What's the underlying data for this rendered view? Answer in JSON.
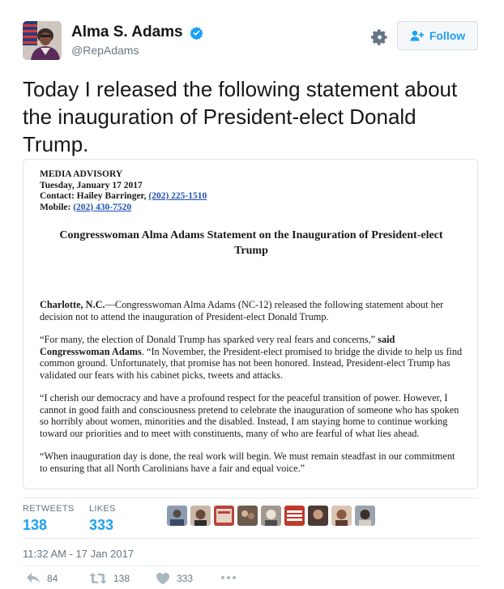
{
  "author": {
    "display_name": "Alma S. Adams",
    "handle": "@RepAdams"
  },
  "follow_button": {
    "label": "Follow"
  },
  "tweet": {
    "text": "Today I released the following statement about the inauguration of President-elect Donald Trump."
  },
  "document": {
    "advisory": "MEDIA ADVISORY",
    "date": "Tuesday, January 17 2017",
    "contact_prefix": "Contact: Hailey Barringer, ",
    "contact_phone": "(202) 225-1510",
    "mobile_prefix": "Mobile: ",
    "mobile_phone": "(202) 430-7520",
    "title": "Congresswoman Alma Adams Statement on the Inauguration of President-elect Trump",
    "p1_lead": "Charlotte, N.C.",
    "p1_body": "—Congresswoman Alma Adams (NC-12) released the following statement about her decision not to attend the inauguration of President-elect Donald Trump.",
    "p2_quote": "“For many, the election of Donald Trump has sparked very real fears and concerns,”",
    "p2_said": " said Congresswoman Adams",
    "p2_body": ". “In November, the President-elect promised to bridge the divide to help us find common ground.  Unfortunately, that promise has not been honored.  Instead, President-elect Trump has validated our fears with his cabinet picks, tweets and attacks.",
    "p3": "“I cherish our democracy and have a profound respect for the peaceful transition of power.  However, I cannot in good faith and consciousness pretend to celebrate the inauguration of someone who has spoken so horribly about women, minorities and the disabled. Instead, I am staying home to continue working toward our priorities and to meet with constituents, many of who are fearful of what lies ahead.",
    "p4": "“When inauguration day is done, the real work will begin. We must remain steadfast in our commitment to ensuring that all North Carolinians have a fair and equal voice.”"
  },
  "stats": {
    "retweets_label": "RETWEETS",
    "retweets_count": "138",
    "likes_label": "LIKES",
    "likes_count": "333"
  },
  "timestamp": "11:32 AM - 17 Jan 2017",
  "actions": {
    "reply_count": "84",
    "retweet_count": "138",
    "like_count": "333"
  },
  "colors": {
    "accent": "#1da1f2",
    "muted": "#657786",
    "text": "#14171a",
    "link": "#1f4fb4"
  },
  "icons": [
    "verified-badge-icon",
    "gear-icon",
    "follow-person-icon",
    "reply-icon",
    "retweet-icon",
    "heart-icon",
    "more-icon"
  ]
}
